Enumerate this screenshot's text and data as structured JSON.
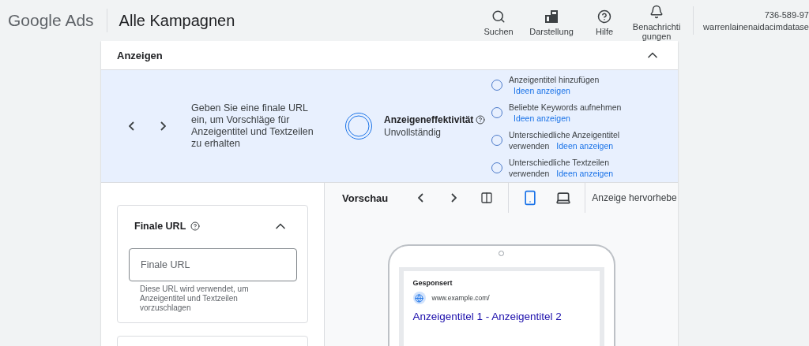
{
  "header": {
    "logo": "Google Ads",
    "title": "Alle Kampagnen",
    "actions": [
      {
        "kind": "search",
        "label": "Suchen"
      },
      {
        "kind": "appearance",
        "label": "Darstellung"
      },
      {
        "kind": "help",
        "label": "Hilfe"
      },
      {
        "kind": "bell",
        "label": "Benachrichti gungen"
      }
    ],
    "account": {
      "id": "736-589-97",
      "email": "warrenlainenaidacimdatase"
    }
  },
  "section": {
    "title": "Anzeigen",
    "expanded": true
  },
  "strength": {
    "hint": "Geben Sie eine finale URL ein, um Vorschläge für Anzeigentitel und Textzeilen zu erhalten",
    "title": "Anzeigeneffektivität",
    "status": "Unvollständig",
    "tips": [
      {
        "text": "Anzeigentitel hinzufügen",
        "link": "Ideen anzeigen",
        "checked": false
      },
      {
        "text": "Beliebte Keywords aufnehmen",
        "link": "Ideen anzeigen",
        "checked": false
      },
      {
        "text": "Unterschiedliche Anzeigentitel verwenden",
        "link": "Ideen anzeigen",
        "checked": false
      },
      {
        "text": "Unterschiedliche Textzeilen verwenden",
        "link": "Ideen anzeigen",
        "checked": false
      }
    ]
  },
  "final_url": {
    "title": "Finale URL",
    "expanded": true,
    "placeholder": "Finale URL",
    "help": "Diese URL wird verwendet, um Anzeigentitel und Textzeilen vorzuschlagen"
  },
  "preview": {
    "title": "Vorschau",
    "devices": [
      {
        "kind": "mobile",
        "selected": true
      },
      {
        "kind": "desktop",
        "selected": false
      }
    ],
    "highlight": "Anzeige hervorhebe",
    "ad": {
      "sponsored": "Gesponsert",
      "url": "www.example.com/",
      "headline": "Anzeigentitel 1 - Anzeigentitel 2"
    }
  }
}
